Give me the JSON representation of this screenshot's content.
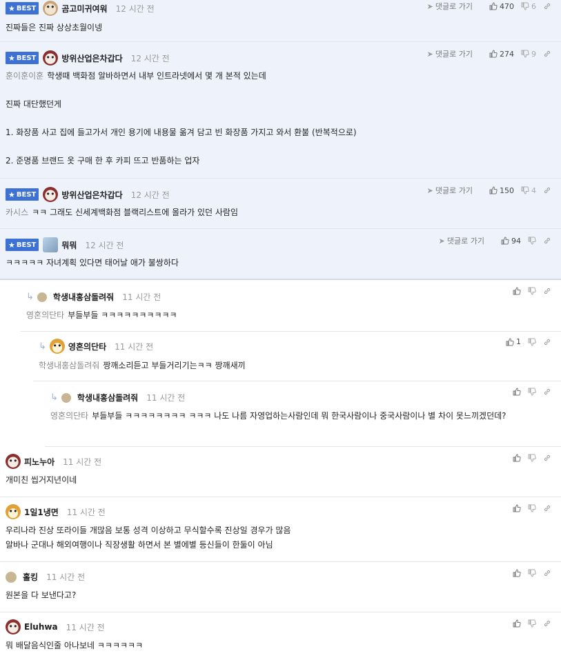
{
  "labels": {
    "best": "BEST",
    "go_reply": "댓글로 가기"
  },
  "comments": [
    {
      "nick": "곰고미귀여워",
      "time": "12 시간 전",
      "up": "470",
      "down": "6",
      "to": "",
      "text": "진짜들은 진짜 상상초월이넹"
    },
    {
      "nick": "방위산업은차갑다",
      "time": "12 시간 전",
      "up": "274",
      "down": "9",
      "to": "훈이훈이훈",
      "paragraphs": [
        "학생때 백화점 알바하면서 내부 인트라넷에서 몇 개 본적 있는데",
        "진짜 대단했던게",
        "1. 화장품 사고 집에 들고가서 개인 용기에 내용물 옮겨 담고 빈 화장품 가지고 와서 환불 (반복적으로)",
        "2. 준명품 브랜드 옷 구매 한 후 카피 뜨고 반품하는 업자"
      ]
    },
    {
      "nick": "방위산업은차갑다",
      "time": "12 시간 전",
      "up": "150",
      "down": "4",
      "to": "카시스",
      "text": "ㅋㅋ 그래도 신세계백화점 블랙리스트에 올라가 있던 사람임"
    },
    {
      "nick": "뭐뭐",
      "time": "12 시간 전",
      "up": "94",
      "down": "",
      "to": "",
      "text": "ㅋㅋㅋㅋㅋ 자녀계획 있다면 태어날 애가 불쌍하다"
    },
    {
      "nick": "학생내홍삼돌려줘",
      "time": "11 시간 전",
      "up": "",
      "down": "",
      "to": "영혼의단타",
      "text": "부들부들 ㅋㅋㅋㅋㅋㅋㅋㅋㅋㅋ"
    },
    {
      "nick": "영혼의단타",
      "time": "11 시간 전",
      "up": "1",
      "down": "",
      "to": "학생내홍삼돌려줘",
      "text": "짱깨소리듣고 부들거리기는ㅋㅋ 짱깨새끼"
    },
    {
      "nick": "학생내홍삼돌려줘",
      "time": "11 시간 전",
      "up": "",
      "down": "",
      "to": "영혼의단타",
      "text": "부들부들 ㅋㅋㅋㅋㅋㅋㅋㅋ ㅋㅋㅋ 나도 나름 자영업하는사람인데 뭐 한국사람이나 중국사람이나 별 차이 못느끼겠던데?"
    },
    {
      "nick": "피노누아",
      "time": "11 시간 전",
      "up": "",
      "down": "",
      "to": "",
      "text": "개미친 씹거지년이네"
    },
    {
      "nick": "1일1냉면",
      "time": "11 시간 전",
      "up": "",
      "down": "",
      "to": "",
      "lines": [
        "우리나라 진상 또라이들 개많음 보통 성격 이상하고 무식할수록 진상일 경우가 많음",
        "알바나 군대나 해외여행이나 직장생활 하면서 본 별에별 등신들이 한둘이 아님"
      ]
    },
    {
      "nick": "홀킹",
      "time": "11 시간 전",
      "up": "",
      "down": "",
      "to": "",
      "text": "원본을 다 보낸다고?"
    },
    {
      "nick": "Eluhwa",
      "time": "11 시간 전",
      "up": "",
      "down": "",
      "to": "",
      "text": "뭐 배달음식인줄 아나보네 ㅋㅋㅋㅋㅋㅋ"
    }
  ]
}
